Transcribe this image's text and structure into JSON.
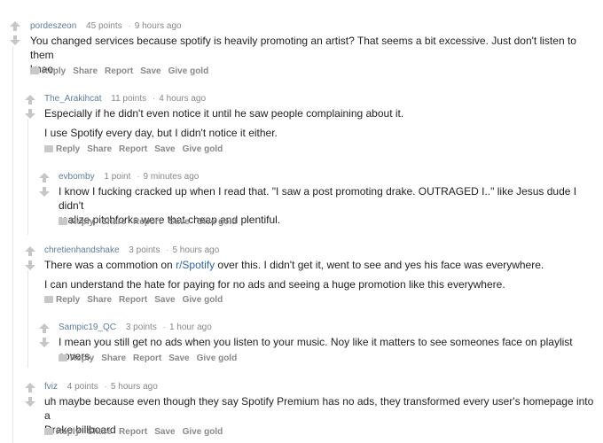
{
  "comments": [
    {
      "author": "pordeszeon",
      "points": "45 points",
      "age": "9 hours ago",
      "lines": [
        "You changed services because spotify is heavily promoting an artist? That seems a bit excessive. Just don't listen to them",
        "lmao"
      ],
      "actions": [
        "Reply",
        "Share",
        "Report",
        "Save",
        "Give gold"
      ]
    },
    {
      "author": "The_Arakihcat",
      "points": "11 points",
      "age": "4 hours ago",
      "lines": [
        "Especially if he didn't even notice it until he saw people complaining about it."
      ],
      "lines2": [
        "I use Spotify every day, but I didn't notice it either."
      ],
      "actions": [
        "Reply",
        "Share",
        "Report",
        "Save",
        "Give gold"
      ]
    },
    {
      "author": "evbomby",
      "points": "1 point",
      "age": "9 minutes ago",
      "lines": [
        "I know I fucking cracked up when I read that. \"I saw a post promoting drake. OUTRAGED I..\" like Jesus dude I didn't",
        "realize pitchforks were that cheap and plentiful."
      ],
      "actions": [
        "Reply",
        "Share",
        "Report",
        "Save",
        "Give gold"
      ]
    },
    {
      "author": "chretienhandshake",
      "points": "3 points",
      "age": "5 hours ago",
      "line_pre": "There was a commotion on ",
      "line_link": "r/Spotify",
      "line_post": " over this. I didn't get it, went to see and yes his face was everywhere.",
      "lines2": [
        "I can understand the hate for paying for no ads and seeing a huge promotion like this everywhere."
      ],
      "actions": [
        "Reply",
        "Share",
        "Report",
        "Save",
        "Give gold"
      ]
    },
    {
      "author": "Sampic19_QC",
      "points": "3 points",
      "age": "1 hour ago",
      "lines": [
        "I mean you still get no ads when you listen to your music. Noy like it matters to see someones face on playlist covers."
      ],
      "actions": [
        "Reply",
        "Share",
        "Report",
        "Save",
        "Give gold"
      ]
    },
    {
      "author": "fviz",
      "points": "4 points",
      "age": "5 hours ago",
      "lines": [
        "uh maybe because even though they say Spotify Premium has no ads, they transformed every user's homepage into a",
        "Drake billboard"
      ],
      "actions": [
        "Reply",
        "Share",
        "Report",
        "Save",
        "Give gold"
      ]
    }
  ],
  "colors": {
    "arrow": "#c6c6c6",
    "author": "#5f7d99",
    "link": "#336699",
    "text": "#222222",
    "meta": "#888888"
  }
}
